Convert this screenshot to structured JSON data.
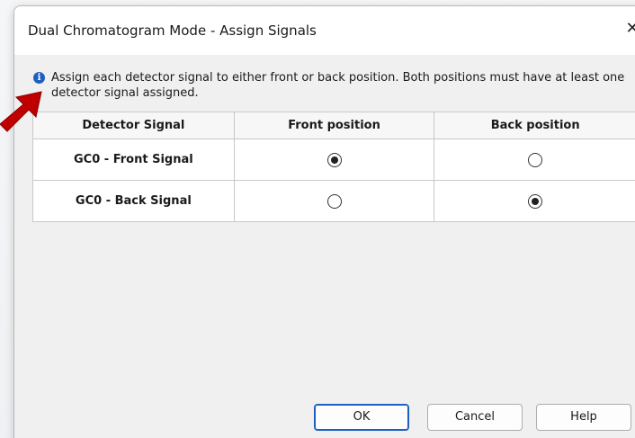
{
  "dialog": {
    "title": "Dual Chromatogram Mode - Assign Signals",
    "close_label": "✕"
  },
  "info": {
    "icon": "info-icon",
    "text": "Assign each detector signal to either front or back position. Both positions must have at least one detector signal assigned."
  },
  "table": {
    "headers": [
      "Detector Signal",
      "Front position",
      "Back position"
    ],
    "rows": [
      {
        "signal": "GC0 - Front Signal",
        "front_selected": true,
        "back_selected": false
      },
      {
        "signal": "GC0 - Back Signal",
        "front_selected": false,
        "back_selected": true
      }
    ]
  },
  "buttons": {
    "ok": "OK",
    "cancel": "Cancel",
    "help": "Help"
  },
  "colors": {
    "accent": "#1f5fbf",
    "annotation_arrow": "#c00000"
  }
}
